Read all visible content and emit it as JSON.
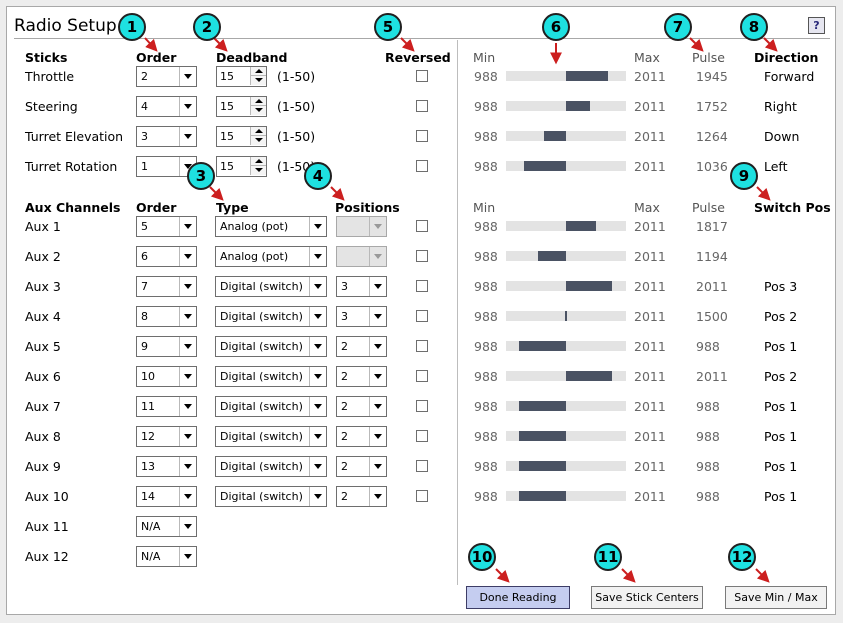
{
  "title": "Radio Setup",
  "help_label": "?",
  "headers": {
    "sticks": "Sticks",
    "order": "Order",
    "deadband": "Deadband",
    "reversed": "Reversed",
    "aux_channels": "Aux Channels",
    "type": "Type",
    "positions": "Positions",
    "min": "Min",
    "max": "Max",
    "pulse": "Pulse",
    "direction": "Direction",
    "switch_pos": "Switch Pos"
  },
  "sticks": [
    {
      "name": "Throttle",
      "order": "2",
      "deadband": "15",
      "range": "(1-50)",
      "min": "988",
      "max": "2011",
      "pulse": "1945",
      "direction": "Forward",
      "bar": [
        0.5,
        0.85
      ]
    },
    {
      "name": "Steering",
      "order": "4",
      "deadband": "15",
      "range": "(1-50)",
      "min": "988",
      "max": "2011",
      "pulse": "1752",
      "direction": "Right",
      "bar": [
        0.5,
        0.7
      ]
    },
    {
      "name": "Turret Elevation",
      "order": "3",
      "deadband": "15",
      "range": "(1-50)",
      "min": "988",
      "max": "2011",
      "pulse": "1264",
      "direction": "Down",
      "bar": [
        0.32,
        0.5
      ]
    },
    {
      "name": "Turret Rotation",
      "order": "1",
      "deadband": "15",
      "range": "(1-50)",
      "min": "988",
      "max": "2011",
      "pulse": "1036",
      "direction": "Left",
      "bar": [
        0.15,
        0.5
      ]
    }
  ],
  "aux": [
    {
      "name": "Aux 1",
      "order": "5",
      "type": "Analog (pot)",
      "positions": "",
      "positions_disabled": true,
      "min": "988",
      "max": "2011",
      "pulse": "1817",
      "switch_pos": "",
      "bar": [
        0.5,
        0.75
      ]
    },
    {
      "name": "Aux 2",
      "order": "6",
      "type": "Analog (pot)",
      "positions": "",
      "positions_disabled": true,
      "min": "988",
      "max": "2011",
      "pulse": "1194",
      "switch_pos": "",
      "bar": [
        0.27,
        0.5
      ]
    },
    {
      "name": "Aux 3",
      "order": "7",
      "type": "Digital (switch)",
      "positions": "3",
      "positions_disabled": false,
      "min": "988",
      "max": "2011",
      "pulse": "2011",
      "switch_pos": "Pos 3",
      "bar": [
        0.5,
        0.88
      ]
    },
    {
      "name": "Aux 4",
      "order": "8",
      "type": "Digital (switch)",
      "positions": "3",
      "positions_disabled": false,
      "min": "988",
      "max": "2011",
      "pulse": "1500",
      "switch_pos": "Pos 2",
      "bar": [
        0.49,
        0.51
      ]
    },
    {
      "name": "Aux 5",
      "order": "9",
      "type": "Digital (switch)",
      "positions": "2",
      "positions_disabled": false,
      "min": "988",
      "max": "2011",
      "pulse": "988",
      "switch_pos": "Pos 1",
      "bar": [
        0.11,
        0.5
      ]
    },
    {
      "name": "Aux 6",
      "order": "10",
      "type": "Digital (switch)",
      "positions": "2",
      "positions_disabled": false,
      "min": "988",
      "max": "2011",
      "pulse": "2011",
      "switch_pos": "Pos 2",
      "bar": [
        0.5,
        0.88
      ]
    },
    {
      "name": "Aux 7",
      "order": "11",
      "type": "Digital (switch)",
      "positions": "2",
      "positions_disabled": false,
      "min": "988",
      "max": "2011",
      "pulse": "988",
      "switch_pos": "Pos 1",
      "bar": [
        0.11,
        0.5
      ]
    },
    {
      "name": "Aux 8",
      "order": "12",
      "type": "Digital (switch)",
      "positions": "2",
      "positions_disabled": false,
      "min": "988",
      "max": "2011",
      "pulse": "988",
      "switch_pos": "Pos 1",
      "bar": [
        0.11,
        0.5
      ]
    },
    {
      "name": "Aux 9",
      "order": "13",
      "type": "Digital (switch)",
      "positions": "2",
      "positions_disabled": false,
      "min": "988",
      "max": "2011",
      "pulse": "988",
      "switch_pos": "Pos 1",
      "bar": [
        0.11,
        0.5
      ]
    },
    {
      "name": "Aux 10",
      "order": "14",
      "type": "Digital (switch)",
      "positions": "2",
      "positions_disabled": false,
      "min": "988",
      "max": "2011",
      "pulse": "988",
      "switch_pos": "Pos 1",
      "bar": [
        0.11,
        0.5
      ]
    },
    {
      "name": "Aux 11",
      "order": "N/A"
    },
    {
      "name": "Aux 12",
      "order": "N/A"
    }
  ],
  "buttons": {
    "done_reading": "Done Reading",
    "save_stick_centers": "Save Stick Centers",
    "save_min_max": "Save Min / Max"
  },
  "callouts": [
    "1",
    "2",
    "3",
    "4",
    "5",
    "6",
    "7",
    "8",
    "9",
    "10",
    "11",
    "12"
  ],
  "colors": {
    "bar_fill": "#4a5263",
    "bar_track": "#e3e3e3",
    "callout_fill": "#1ee1e1",
    "callout_arrow": "#cc1f1f",
    "primary_button": "#c5cdf0"
  }
}
